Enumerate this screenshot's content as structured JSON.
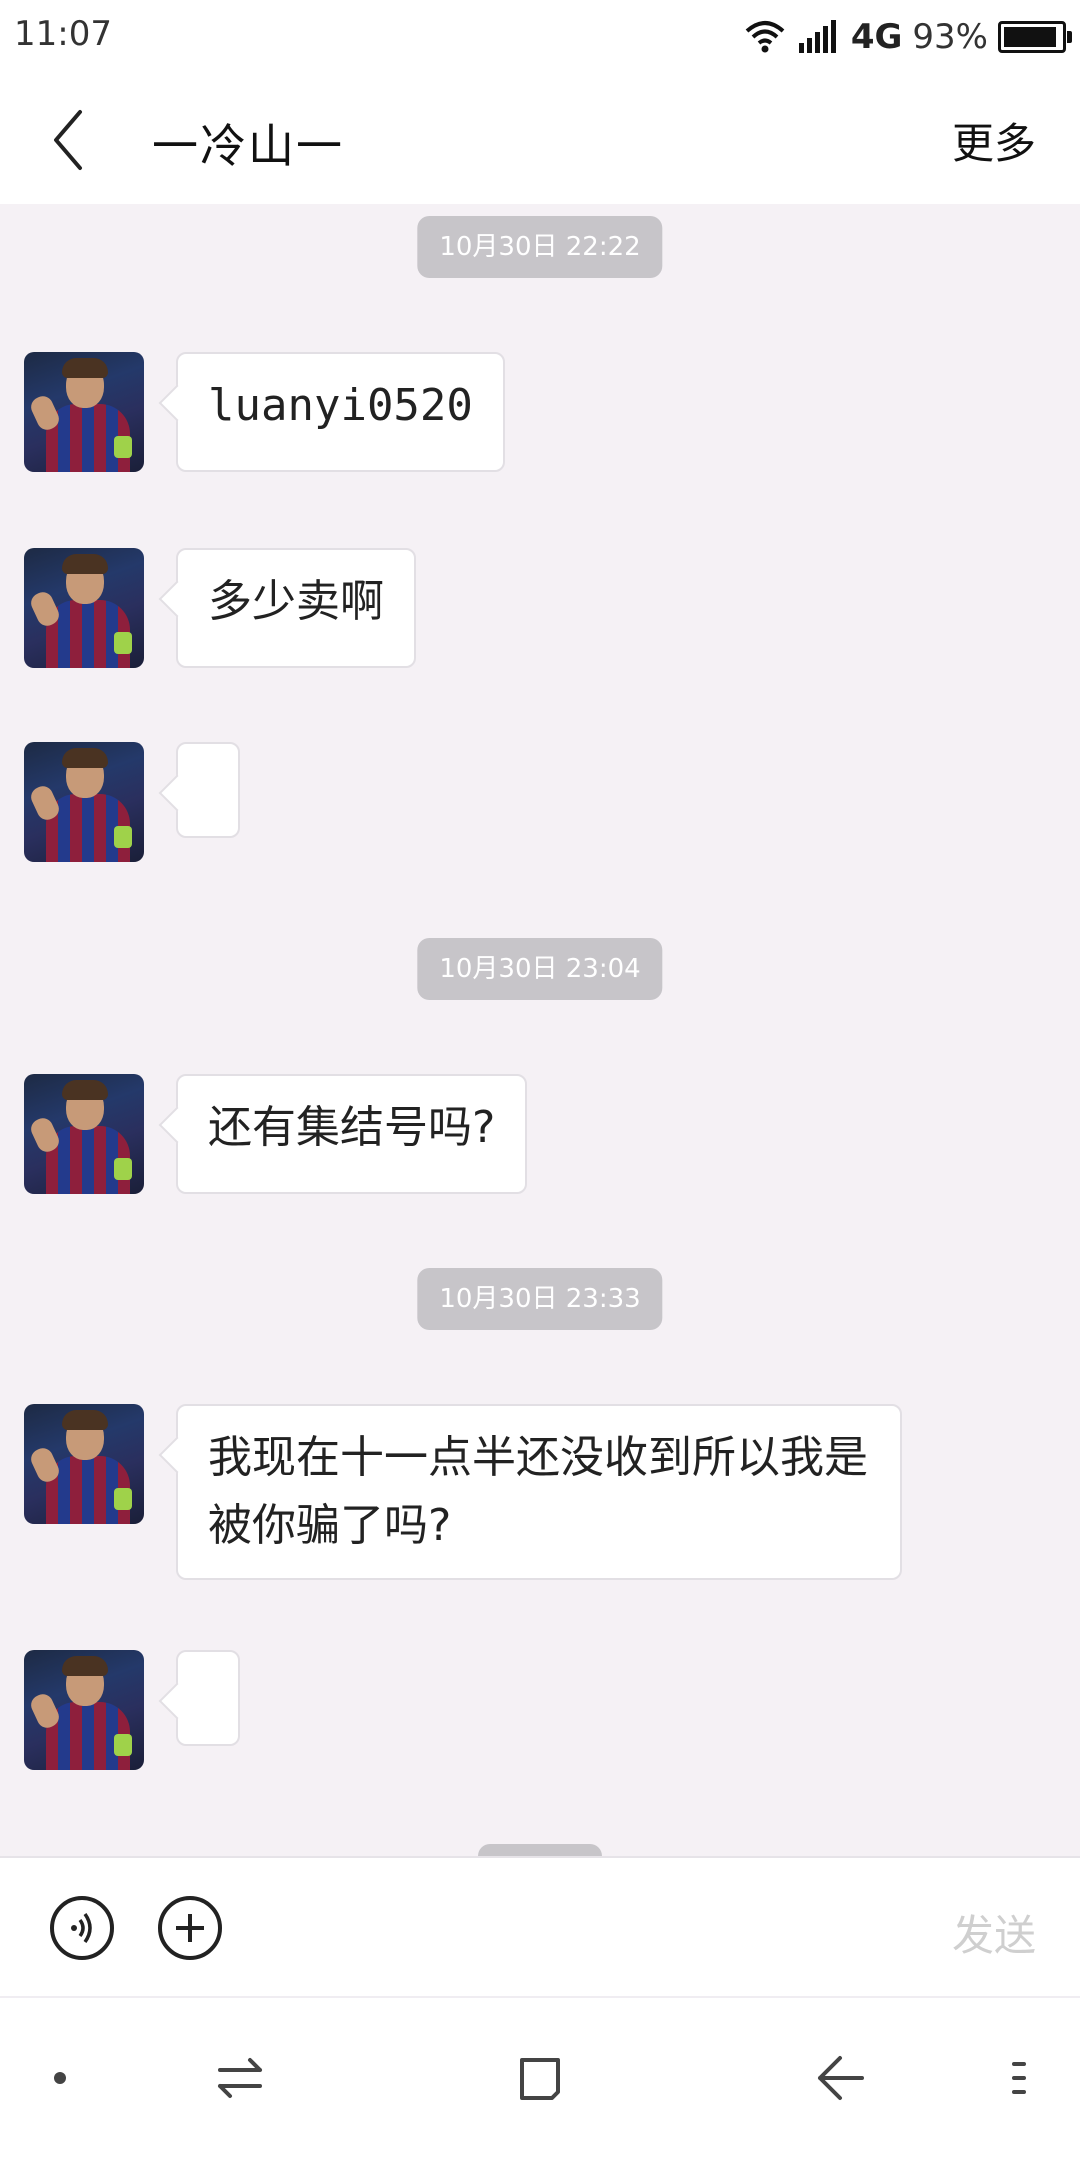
{
  "status_bar": {
    "time": "11:07",
    "network": "4G",
    "battery_percent_text": "93%",
    "battery_level": 0.93
  },
  "header": {
    "title": "一冷山一",
    "more_label": "更多"
  },
  "messages": [
    {
      "type": "timestamp",
      "text": "10月30日 22:22"
    },
    {
      "type": "incoming",
      "text": "luanyi0520"
    },
    {
      "type": "incoming",
      "text": "多少卖啊"
    },
    {
      "type": "incoming",
      "text": ""
    },
    {
      "type": "timestamp",
      "text": "10月30日 23:04"
    },
    {
      "type": "incoming",
      "text": "还有集结号吗?"
    },
    {
      "type": "timestamp",
      "text": "10月30日 23:33"
    },
    {
      "type": "incoming",
      "text": "我现在十一点半还没收到所以我是被你骗了吗?"
    },
    {
      "type": "incoming",
      "text": ""
    }
  ],
  "input_bar": {
    "send_label": "发送"
  },
  "icons": {
    "back": "chevron-left-icon",
    "voice": "voice-icon",
    "plus": "plus-icon",
    "nav_dot": "dot-icon",
    "nav_switch": "switch-icon",
    "nav_home": "home-square-icon",
    "nav_back": "back-arrow-icon",
    "nav_menu": "menu-icon"
  },
  "colors": {
    "chat_background": "#f5f1f5",
    "timestamp_badge": "#c7c5c9",
    "send_disabled": "#cfcfcf"
  }
}
